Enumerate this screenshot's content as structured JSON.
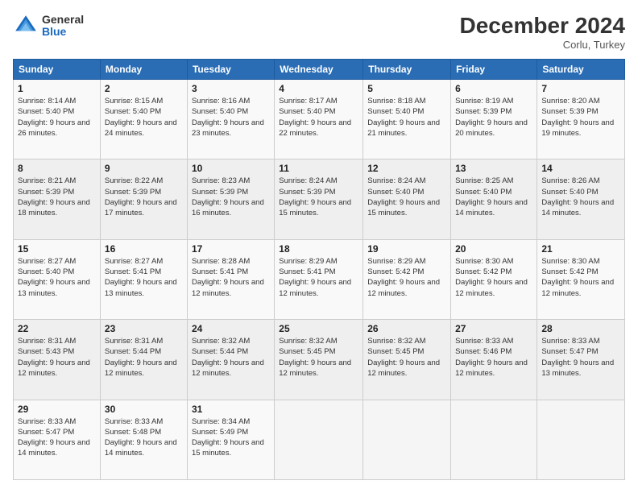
{
  "logo": {
    "general": "General",
    "blue": "Blue"
  },
  "title": "December 2024",
  "location": "Corlu, Turkey",
  "days_of_week": [
    "Sunday",
    "Monday",
    "Tuesday",
    "Wednesday",
    "Thursday",
    "Friday",
    "Saturday"
  ],
  "weeks": [
    [
      {
        "day": "1",
        "sunrise": "8:14 AM",
        "sunset": "5:40 PM",
        "daylight": "9 hours and 26 minutes."
      },
      {
        "day": "2",
        "sunrise": "8:15 AM",
        "sunset": "5:40 PM",
        "daylight": "9 hours and 24 minutes."
      },
      {
        "day": "3",
        "sunrise": "8:16 AM",
        "sunset": "5:40 PM",
        "daylight": "9 hours and 23 minutes."
      },
      {
        "day": "4",
        "sunrise": "8:17 AM",
        "sunset": "5:40 PM",
        "daylight": "9 hours and 22 minutes."
      },
      {
        "day": "5",
        "sunrise": "8:18 AM",
        "sunset": "5:40 PM",
        "daylight": "9 hours and 21 minutes."
      },
      {
        "day": "6",
        "sunrise": "8:19 AM",
        "sunset": "5:39 PM",
        "daylight": "9 hours and 20 minutes."
      },
      {
        "day": "7",
        "sunrise": "8:20 AM",
        "sunset": "5:39 PM",
        "daylight": "9 hours and 19 minutes."
      }
    ],
    [
      {
        "day": "8",
        "sunrise": "8:21 AM",
        "sunset": "5:39 PM",
        "daylight": "9 hours and 18 minutes."
      },
      {
        "day": "9",
        "sunrise": "8:22 AM",
        "sunset": "5:39 PM",
        "daylight": "9 hours and 17 minutes."
      },
      {
        "day": "10",
        "sunrise": "8:23 AM",
        "sunset": "5:39 PM",
        "daylight": "9 hours and 16 minutes."
      },
      {
        "day": "11",
        "sunrise": "8:24 AM",
        "sunset": "5:39 PM",
        "daylight": "9 hours and 15 minutes."
      },
      {
        "day": "12",
        "sunrise": "8:24 AM",
        "sunset": "5:40 PM",
        "daylight": "9 hours and 15 minutes."
      },
      {
        "day": "13",
        "sunrise": "8:25 AM",
        "sunset": "5:40 PM",
        "daylight": "9 hours and 14 minutes."
      },
      {
        "day": "14",
        "sunrise": "8:26 AM",
        "sunset": "5:40 PM",
        "daylight": "9 hours and 14 minutes."
      }
    ],
    [
      {
        "day": "15",
        "sunrise": "8:27 AM",
        "sunset": "5:40 PM",
        "daylight": "9 hours and 13 minutes."
      },
      {
        "day": "16",
        "sunrise": "8:27 AM",
        "sunset": "5:41 PM",
        "daylight": "9 hours and 13 minutes."
      },
      {
        "day": "17",
        "sunrise": "8:28 AM",
        "sunset": "5:41 PM",
        "daylight": "9 hours and 12 minutes."
      },
      {
        "day": "18",
        "sunrise": "8:29 AM",
        "sunset": "5:41 PM",
        "daylight": "9 hours and 12 minutes."
      },
      {
        "day": "19",
        "sunrise": "8:29 AM",
        "sunset": "5:42 PM",
        "daylight": "9 hours and 12 minutes."
      },
      {
        "day": "20",
        "sunrise": "8:30 AM",
        "sunset": "5:42 PM",
        "daylight": "9 hours and 12 minutes."
      },
      {
        "day": "21",
        "sunrise": "8:30 AM",
        "sunset": "5:42 PM",
        "daylight": "9 hours and 12 minutes."
      }
    ],
    [
      {
        "day": "22",
        "sunrise": "8:31 AM",
        "sunset": "5:43 PM",
        "daylight": "9 hours and 12 minutes."
      },
      {
        "day": "23",
        "sunrise": "8:31 AM",
        "sunset": "5:44 PM",
        "daylight": "9 hours and 12 minutes."
      },
      {
        "day": "24",
        "sunrise": "8:32 AM",
        "sunset": "5:44 PM",
        "daylight": "9 hours and 12 minutes."
      },
      {
        "day": "25",
        "sunrise": "8:32 AM",
        "sunset": "5:45 PM",
        "daylight": "9 hours and 12 minutes."
      },
      {
        "day": "26",
        "sunrise": "8:32 AM",
        "sunset": "5:45 PM",
        "daylight": "9 hours and 12 minutes."
      },
      {
        "day": "27",
        "sunrise": "8:33 AM",
        "sunset": "5:46 PM",
        "daylight": "9 hours and 12 minutes."
      },
      {
        "day": "28",
        "sunrise": "8:33 AM",
        "sunset": "5:47 PM",
        "daylight": "9 hours and 13 minutes."
      }
    ],
    [
      {
        "day": "29",
        "sunrise": "8:33 AM",
        "sunset": "5:47 PM",
        "daylight": "9 hours and 14 minutes."
      },
      {
        "day": "30",
        "sunrise": "8:33 AM",
        "sunset": "5:48 PM",
        "daylight": "9 hours and 14 minutes."
      },
      {
        "day": "31",
        "sunrise": "8:34 AM",
        "sunset": "5:49 PM",
        "daylight": "9 hours and 15 minutes."
      },
      null,
      null,
      null,
      null
    ]
  ]
}
